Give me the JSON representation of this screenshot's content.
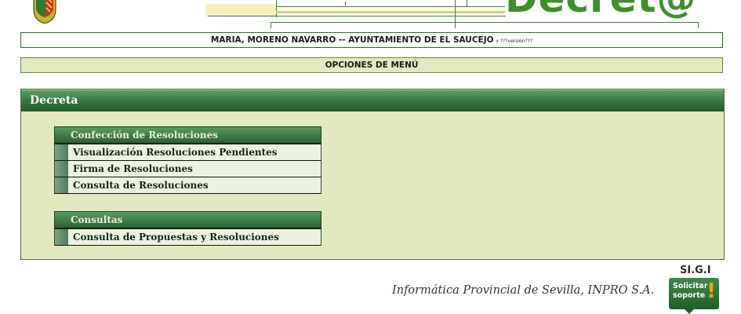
{
  "header": {
    "logo_text": "Decret@",
    "crest_icon": "municipal-coat-of-arms-icon"
  },
  "user_bar": {
    "text": "MARIA, MORENO NAVARRO -- AYUNTAMIENTO DE EL SAUCEJO",
    "version": "v ???version???"
  },
  "menu_bar": {
    "label": "OPCIONES DE MENÚ"
  },
  "panel": {
    "title": "Decreta",
    "groups": [
      {
        "title": "Confección de Resoluciones",
        "items": [
          {
            "label": "Visualización Resoluciones Pendientes"
          },
          {
            "label": "Firma de Resoluciones"
          },
          {
            "label": "Consulta de Resoluciones"
          }
        ]
      },
      {
        "title": "Consultas",
        "items": [
          {
            "label": "Consulta de Propuestas y Resoluciones"
          }
        ]
      }
    ]
  },
  "footer": {
    "company": "Informática Provincial de Sevilla, INPRO S.A.",
    "sigi_label": "SI.G.I",
    "support_label": "Solicitar soporte",
    "support_icon": "exclamation-icon"
  },
  "colors": {
    "brand_green": "#3f8f2a",
    "panel_bg": "#e2e9bf",
    "header_gradient_dark": "#23582d"
  }
}
